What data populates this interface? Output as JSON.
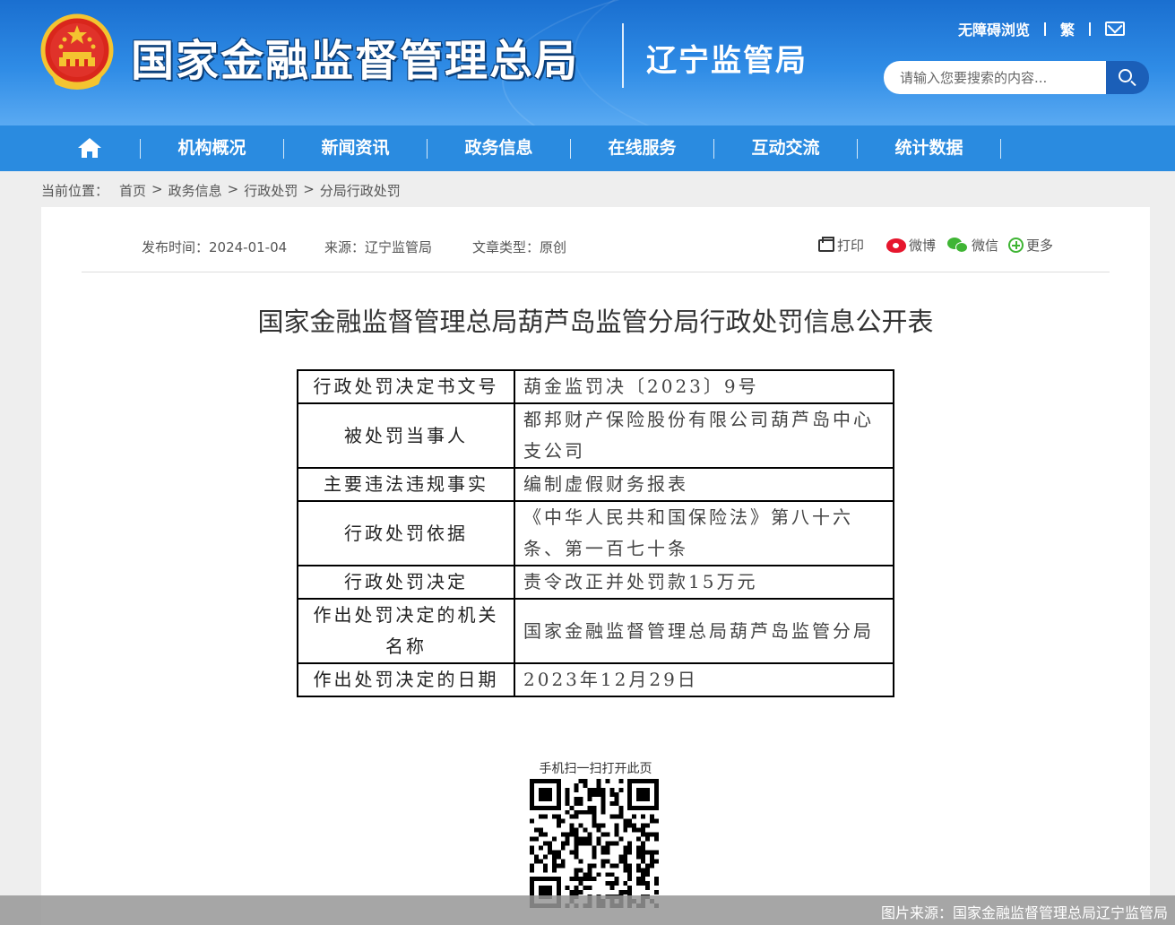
{
  "header": {
    "site_title": "国家金融监督管理总局",
    "sub_title": "辽宁监管局",
    "accessibility_link": "无障碍浏览",
    "traditional_link": "繁",
    "search_placeholder": "请输入您要搜索的内容..."
  },
  "nav": {
    "items": [
      {
        "label": "机构概况"
      },
      {
        "label": "新闻资讯"
      },
      {
        "label": "政务信息"
      },
      {
        "label": "在线服务"
      },
      {
        "label": "互动交流"
      },
      {
        "label": "统计数据"
      }
    ]
  },
  "breadcrumb": {
    "prefix": "当前位置：",
    "items": [
      "首页",
      "政务信息",
      "行政处罚",
      "分局行政处罚"
    ],
    "separator": ">"
  },
  "meta": {
    "publish_time": "发布时间：2024-01-04",
    "source": "来源：辽宁监管局",
    "article_type": "文章类型：原创"
  },
  "share": {
    "print": "打印",
    "weibo": "微博",
    "wechat": "微信",
    "more": "更多"
  },
  "article": {
    "title": "国家金融监督管理总局葫芦岛监管分局行政处罚信息公开表",
    "rows": [
      {
        "key": "行政处罚决定书文号",
        "value": "葫金监罚决〔2023〕9号"
      },
      {
        "key": "被处罚当事人",
        "value": "都邦财产保险股份有限公司葫芦岛中心支公司"
      },
      {
        "key": "主要违法违规事实",
        "value": "编制虚假财务报表"
      },
      {
        "key": "行政处罚依据",
        "value": "《中华人民共和国保险法》第八十六条、第一百七十条"
      },
      {
        "key": "行政处罚决定",
        "value": "责令改正并处罚款15万元"
      },
      {
        "key": "作出处罚决定的机关名称",
        "value": "国家金融监督管理总局葫芦岛监管分局"
      },
      {
        "key": "作出处罚决定的日期",
        "value": "2023年12月29日"
      }
    ]
  },
  "qr": {
    "label": "手机扫一扫打开此页"
  },
  "source_caption": "图片来源：国家金融监督管理总局辽宁监管局",
  "colors": {
    "header_blue": "#2f8ce6",
    "nav_blue": "#2a8be0",
    "search_button": "#1b5fb8"
  }
}
